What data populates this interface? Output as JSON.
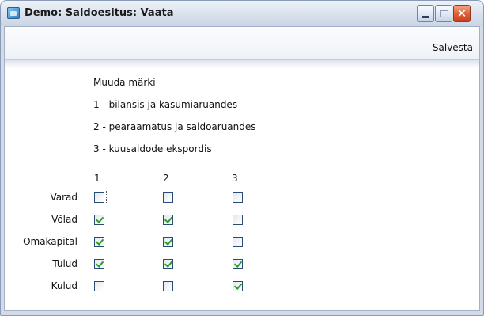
{
  "window": {
    "title": "Demo: Saldoesitus: Vaata"
  },
  "toolbar": {
    "save_label": "Salvesta"
  },
  "info": {
    "heading": "Muuda märki",
    "line1": "1 - bilansis ja kasumiaruandes",
    "line2": "2 - pearaamatus ja saldoaruandes",
    "line3": "3 - kuusaldode ekspordis"
  },
  "columns": [
    "1",
    "2",
    "3"
  ],
  "rows": [
    {
      "label": "Varad",
      "checks": [
        false,
        false,
        false
      ]
    },
    {
      "label": "Võlad",
      "checks": [
        true,
        true,
        false
      ]
    },
    {
      "label": "Omakapital",
      "checks": [
        true,
        true,
        false
      ]
    },
    {
      "label": "Tulud",
      "checks": [
        true,
        true,
        true
      ]
    },
    {
      "label": "Kulud",
      "checks": [
        false,
        false,
        true
      ]
    }
  ],
  "colors": {
    "check": "#21a121",
    "frame": "#d3dbe9",
    "close_button": "#e2613a"
  },
  "icons": {
    "app": "app-window-icon",
    "minimize": "minimize-icon",
    "maximize": "maximize-icon",
    "close": "close-icon"
  }
}
